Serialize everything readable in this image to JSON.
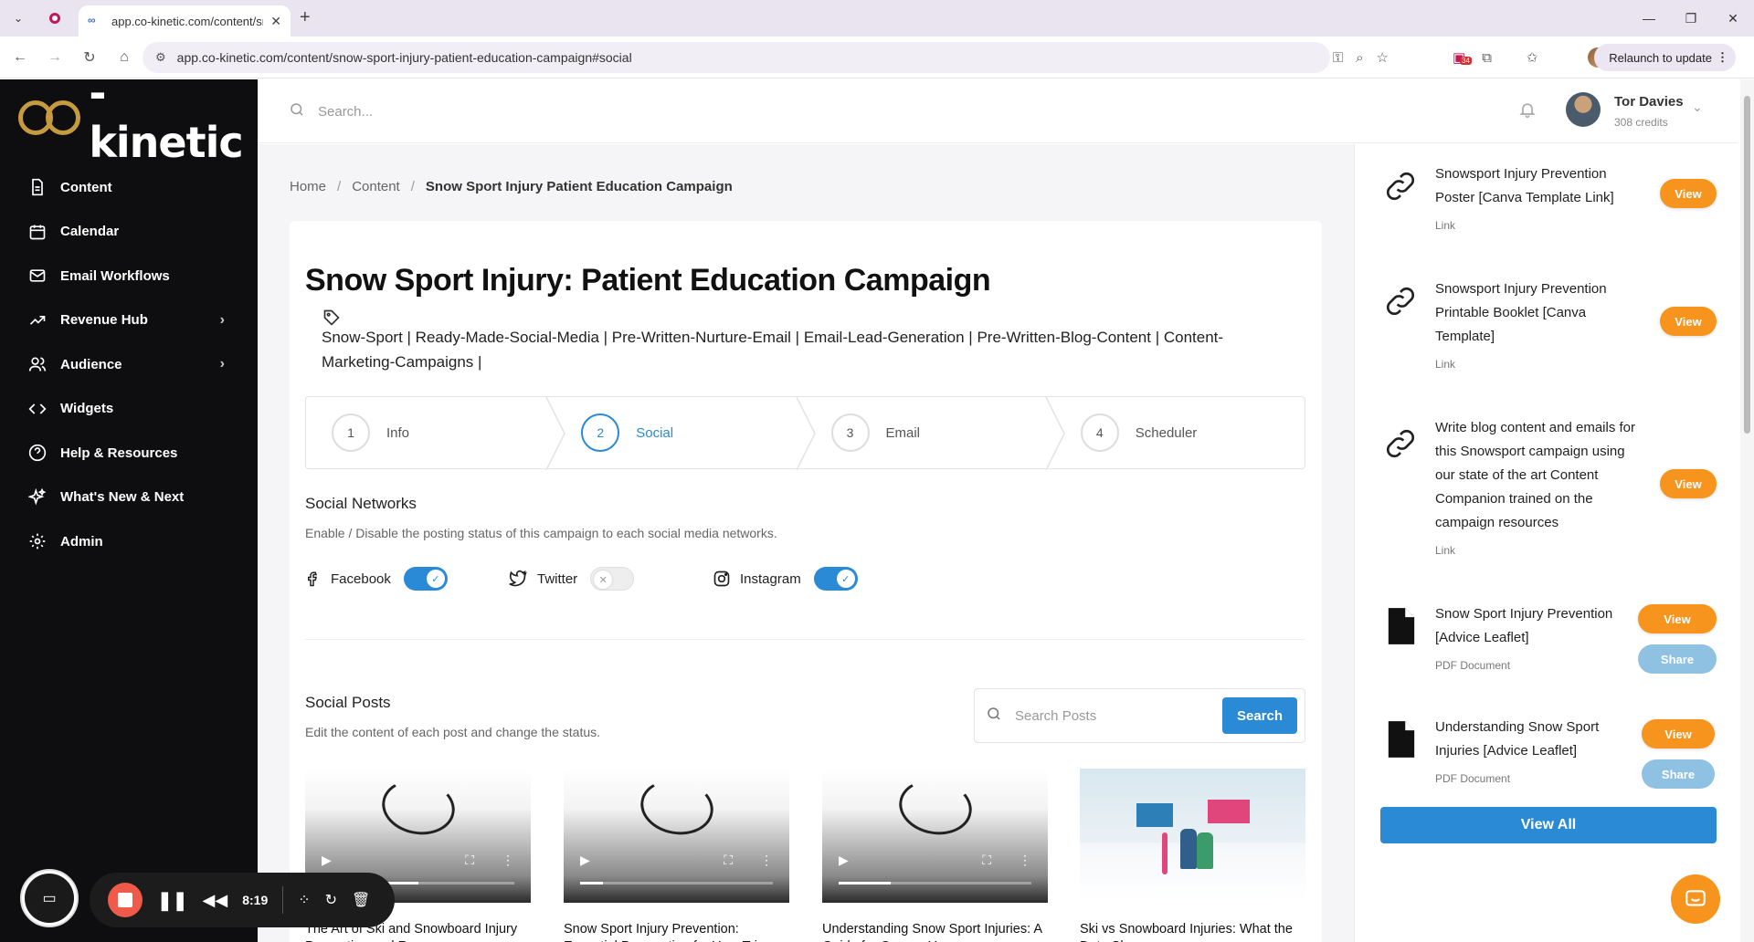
{
  "browser": {
    "tab_title": "app.co-kinetic.com/content/sn",
    "url": "app.co-kinetic.com/content/snow-sport-injury-patient-education-campaign#social",
    "relaunch_label": "Relaunch to update",
    "ext_badge": "34"
  },
  "brand": {
    "logo_text": "-kinetic"
  },
  "sidebar": {
    "items": [
      {
        "label": "Content",
        "icon": "document-icon"
      },
      {
        "label": "Calendar",
        "icon": "calendar-icon"
      },
      {
        "label": "Email Workflows",
        "icon": "mail-icon"
      },
      {
        "label": "Revenue Hub",
        "icon": "trending-up-icon",
        "has_children": true
      },
      {
        "label": "Audience",
        "icon": "users-icon",
        "has_children": true
      },
      {
        "label": "Widgets",
        "icon": "code-icon"
      },
      {
        "label": "Help & Resources",
        "icon": "help-icon"
      },
      {
        "label": "What's New & Next",
        "icon": "sparkles-icon"
      },
      {
        "label": "Admin",
        "icon": "gear-icon"
      }
    ]
  },
  "header": {
    "search_placeholder": "Search...",
    "user_name": "Tor Davies",
    "user_credits": "308 credits"
  },
  "breadcrumb": {
    "home": "Home",
    "section": "Content",
    "current": "Snow Sport Injury Patient Education Campaign",
    "separator": "/"
  },
  "campaign": {
    "title": "Snow Sport Injury: Patient Education Campaign",
    "tags": "Snow-Sport | Ready-Made-Social-Media | Pre-Written-Nurture-Email | Email-Lead-Generation | Pre-Written-Blog-Content | Content-Marketing-Campaigns |"
  },
  "steps": [
    {
      "num": "1",
      "label": "Info",
      "active": false
    },
    {
      "num": "2",
      "label": "Social",
      "active": true
    },
    {
      "num": "3",
      "label": "Email",
      "active": false
    },
    {
      "num": "4",
      "label": "Scheduler",
      "active": false
    }
  ],
  "social_networks": {
    "title": "Social Networks",
    "subtitle": "Enable / Disable the posting status of this campaign to each social media networks.",
    "networks": [
      {
        "label": "Facebook",
        "icon": "facebook-icon",
        "enabled": true
      },
      {
        "label": "Twitter",
        "icon": "twitter-icon",
        "enabled": false
      },
      {
        "label": "Instagram",
        "icon": "instagram-icon",
        "enabled": true
      }
    ]
  },
  "social_posts": {
    "title": "Social Posts",
    "subtitle": "Edit the content of each post and change the status.",
    "search_placeholder": "Search Posts",
    "search_button": "Search",
    "posts": [
      {
        "title": "The Art of Ski and Snowboard Injury Prevention and Recovery",
        "type": "video",
        "progress": 0.5
      },
      {
        "title": "Snow Sport Injury Prevention: Essential Preparation for Your Trip",
        "type": "video",
        "progress": 0.12
      },
      {
        "title": "Understanding Snow Sport Injuries: A Guide for Once-a-Year",
        "type": "video",
        "progress": 0.27
      },
      {
        "title": "Ski vs Snowboard Injuries: What the Data Shows",
        "type": "image"
      }
    ]
  },
  "resources": {
    "items": [
      {
        "title": "Snowsport Injury Prevention Poster [Canva Template Link]",
        "kind": "Link",
        "icon": "link-icon",
        "view": "View"
      },
      {
        "title": "Snowsport Injury Prevention Printable Booklet [Canva Template]",
        "kind": "Link",
        "icon": "link-icon",
        "view": "View"
      },
      {
        "title": "Write blog content and emails for this Snowsport campaign using our state of the art Content Companion trained on the campaign resources",
        "kind": "Link",
        "icon": "link-icon",
        "view": "View"
      },
      {
        "title": "Snow Sport Injury Prevention [Advice Leaflet]",
        "kind": "PDF Document",
        "icon": "file-icon",
        "view": "View",
        "share": "Share"
      },
      {
        "title": "Understanding Snow Sport Injuries [Advice Leaflet]",
        "kind": "PDF Document",
        "icon": "file-icon",
        "view": "View",
        "share": "Share"
      }
    ],
    "view_all": "View All"
  },
  "recorder": {
    "time": "8:19"
  },
  "colors": {
    "accent": "#2a8ad6",
    "orange": "#f7941d",
    "sidebar": "#0e0e10"
  }
}
